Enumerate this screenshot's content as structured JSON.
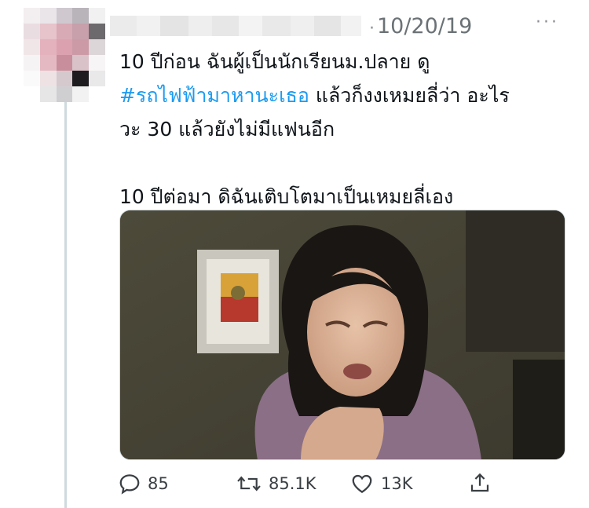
{
  "tweet": {
    "date": "10/20/19",
    "separator": "·",
    "more": "···",
    "lines": [
      "10 ปีก่อน ฉันผู้เป็นนักเรียนม.ปลาย ดู",
      "แล้วก็งงเหมยลี่ว่า อะไร",
      "วะ 30 แล้วยังไม่มีแฟนอีก",
      "10 ปีต่อมา ดิฉันเติบโตมาเป็นเหมยลี่เอง"
    ],
    "hashtag": "#รถไฟฟ้ามาหานะเธอ"
  },
  "actions": {
    "reply_count": "85",
    "retweet_count": "85.1K",
    "like_count": "13K"
  },
  "icons": {
    "reply": "reply-icon",
    "retweet": "retweet-icon",
    "like": "heart-icon",
    "share": "share-icon"
  },
  "colors": {
    "hashtag": "#1d9bf0",
    "date": "#6b7276",
    "thread_line": "#cfd9de"
  }
}
